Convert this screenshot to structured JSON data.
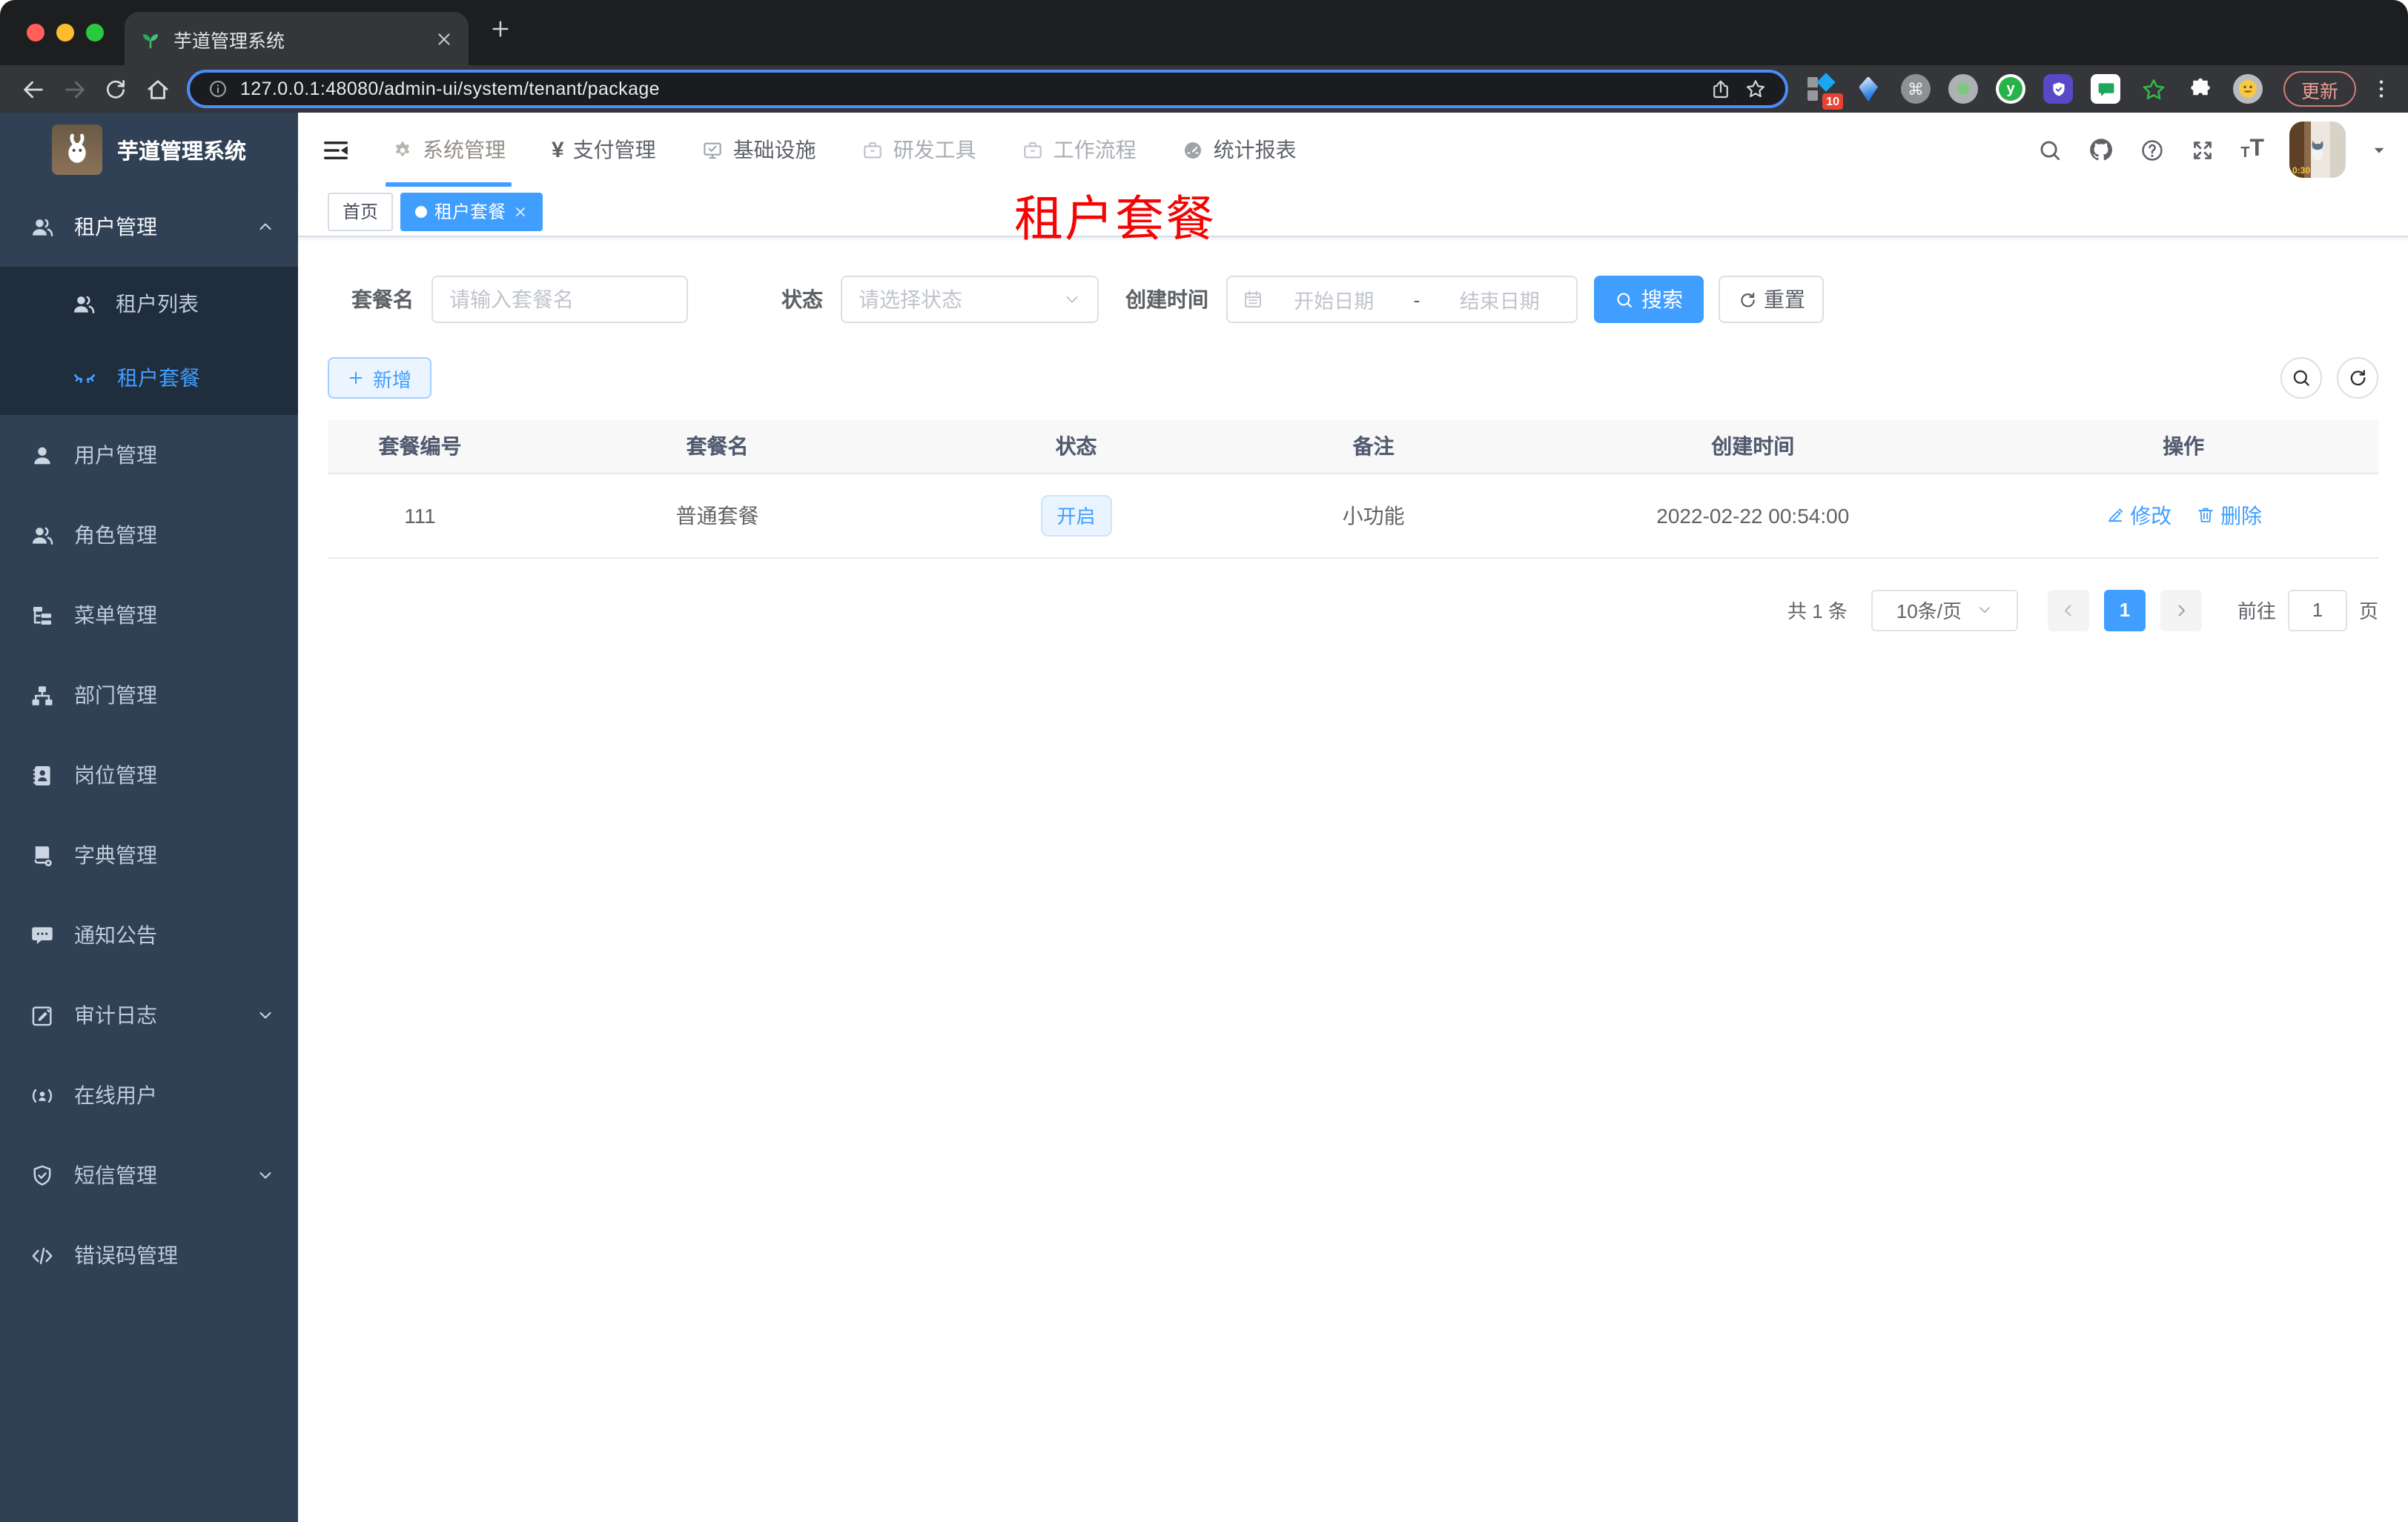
{
  "browser": {
    "tab_title": "芋道管理系统",
    "url": "127.0.0.1:48080/admin-ui/system/tenant/package",
    "update_label": "更新",
    "extension_badge": "10",
    "avatar_time": "0:30"
  },
  "app": {
    "name": "芋道管理系统"
  },
  "topnav": {
    "items": [
      {
        "label": "系统管理"
      },
      {
        "label": "支付管理"
      },
      {
        "label": "基础设施"
      },
      {
        "label": "研发工具"
      },
      {
        "label": "工作流程"
      },
      {
        "label": "统计报表"
      }
    ]
  },
  "sidebar": {
    "items": [
      {
        "label": "租户管理"
      },
      {
        "label": "租户列表"
      },
      {
        "label": "租户套餐"
      },
      {
        "label": "用户管理"
      },
      {
        "label": "角色管理"
      },
      {
        "label": "菜单管理"
      },
      {
        "label": "部门管理"
      },
      {
        "label": "岗位管理"
      },
      {
        "label": "字典管理"
      },
      {
        "label": "通知公告"
      },
      {
        "label": "审计日志"
      },
      {
        "label": "在线用户"
      },
      {
        "label": "短信管理"
      },
      {
        "label": "错误码管理"
      }
    ]
  },
  "tags": {
    "home": "首页",
    "current": "租户套餐"
  },
  "overlay_title": "租户套餐",
  "filters": {
    "name_label": "套餐名",
    "name_placeholder": "请输入套餐名",
    "status_label": "状态",
    "status_placeholder": "请选择状态",
    "date_label": "创建时间",
    "date_start": "开始日期",
    "date_sep": "-",
    "date_end": "结束日期",
    "search": "搜索",
    "reset": "重置"
  },
  "toolbar": {
    "add": "新增"
  },
  "table": {
    "columns": [
      "套餐编号",
      "套餐名",
      "状态",
      "备注",
      "创建时间",
      "操作"
    ],
    "rows": [
      {
        "id": "111",
        "name": "普通套餐",
        "status": "开启",
        "remark": "小功能",
        "created": "2022-02-22 00:54:00",
        "edit": "修改",
        "delete": "删除"
      }
    ]
  },
  "pagination": {
    "total": "共 1 条",
    "size": "10条/页",
    "page": "1",
    "goto": "前往",
    "goto_value": "1",
    "unit": "页"
  },
  "colors": {
    "primary": "#409eff",
    "sidebar_bg": "#304156",
    "submenu_bg": "#1f2d3d",
    "title_red": "#f50403",
    "tag_active": "#409eff",
    "status_tag_bg": "#e9f4ff"
  }
}
